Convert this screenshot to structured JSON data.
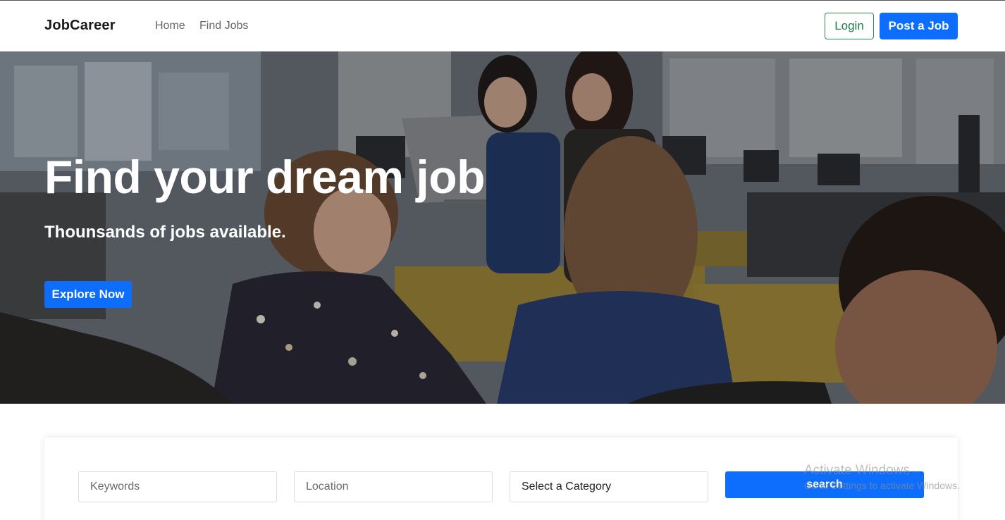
{
  "navbar": {
    "brand": "JobCareer",
    "links": [
      "Home",
      "Find Jobs"
    ],
    "login_label": "Login",
    "post_job_label": "Post a Job"
  },
  "hero": {
    "title": "Find your dream job",
    "subtitle": "Thounsands of jobs available.",
    "cta_label": "Explore Now"
  },
  "search": {
    "keywords_placeholder": "Keywords",
    "location_placeholder": "Location",
    "category_selected": "Select a Category",
    "search_label": "search"
  },
  "watermark": {
    "line1": "Activate Windows",
    "line2": "Go to Settings to activate Windows."
  },
  "colors": {
    "primary": "#0d6efd",
    "login_border": "#2e8b57",
    "brand_text": "#1a1a1a"
  }
}
